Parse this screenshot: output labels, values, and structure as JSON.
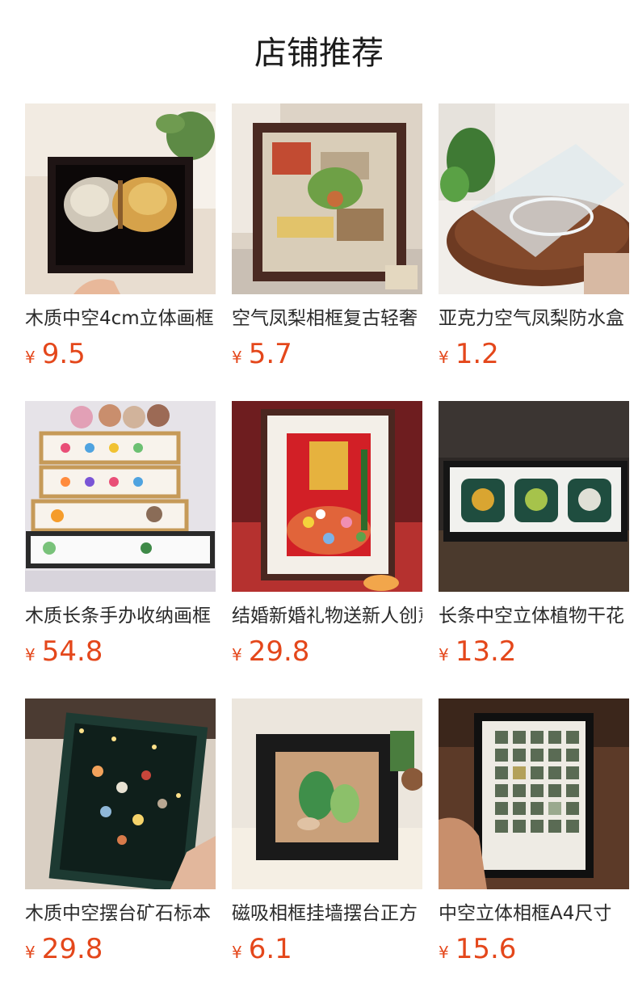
{
  "header": {
    "title": "店铺推荐"
  },
  "products": [
    {
      "name": "木质中空4cm立体画框",
      "currency": "¥",
      "price": "9.5",
      "image": "butterfly-dried-flower-frame"
    },
    {
      "name": "空气凤梨相框复古轻奢",
      "currency": "¥",
      "price": "5.7",
      "image": "air-plant-vintage-frame"
    },
    {
      "name": "亚克力空气凤梨防水盒",
      "currency": "¥",
      "price": "1.2",
      "image": "acrylic-air-plant-box"
    },
    {
      "name": "木质长条手办收纳画框",
      "currency": "¥",
      "price": "54.8",
      "image": "figure-display-shelf"
    },
    {
      "name": "结婚新婚礼物送新人创意",
      "currency": "¥",
      "price": "29.8",
      "image": "wedding-flower-frame"
    },
    {
      "name": "长条中空立体植物干花",
      "currency": "¥",
      "price": "13.2",
      "image": "long-plant-specimen-frame"
    },
    {
      "name": "木质中空摆台矿石标本",
      "currency": "¥",
      "price": "29.8",
      "image": "mineral-specimen-frame"
    },
    {
      "name": "磁吸相框挂墙摆台正方",
      "currency": "¥",
      "price": "6.1",
      "image": "magnetic-square-frame"
    },
    {
      "name": "中空立体相框A4尺寸",
      "currency": "¥",
      "price": "15.6",
      "image": "a4-specimen-frame"
    }
  ]
}
